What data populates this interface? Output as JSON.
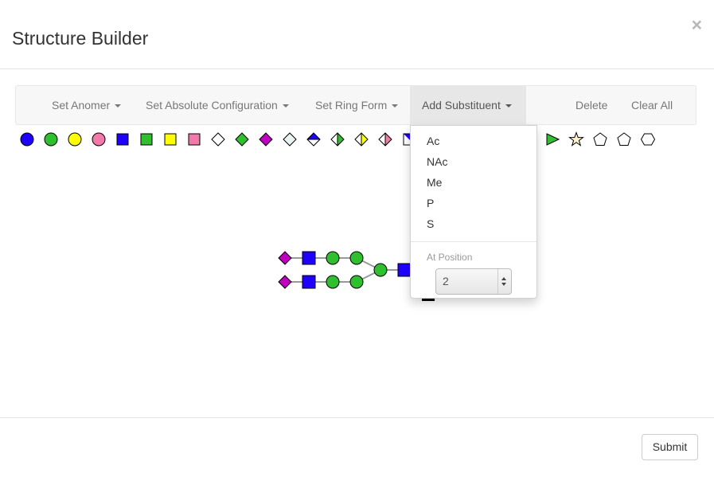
{
  "modal": {
    "title": "Structure Builder",
    "close_symbol": "×"
  },
  "toolbar": {
    "items": [
      {
        "label": "Set Anomer",
        "has_caret": true
      },
      {
        "label": "Set Absolute Configuration",
        "has_caret": true
      },
      {
        "label": "Set Ring Form",
        "has_caret": true
      },
      {
        "label": "Add Substituent",
        "has_caret": true,
        "active": true
      },
      {
        "label": "Delete",
        "has_caret": false
      },
      {
        "label": "Clear All",
        "has_caret": false
      }
    ]
  },
  "palette": {
    "symbols": [
      {
        "shape": "circle",
        "fill": "#1f00ff"
      },
      {
        "shape": "circle",
        "fill": "#2fbf2f"
      },
      {
        "shape": "circle",
        "fill": "#ffff00"
      },
      {
        "shape": "circle",
        "fill": "#f07aaa"
      },
      {
        "shape": "square",
        "fill": "#1f00ff"
      },
      {
        "shape": "square",
        "fill": "#2fbf2f"
      },
      {
        "shape": "square",
        "fill": "#ffff00"
      },
      {
        "shape": "square",
        "fill": "#f07aaa"
      },
      {
        "shape": "diamond",
        "fill": "#ffffff"
      },
      {
        "shape": "diamond",
        "fill": "#2fbf2f"
      },
      {
        "shape": "diamond",
        "fill": "#c000c0"
      },
      {
        "shape": "diamond-light",
        "fill": "#e8f4f4"
      },
      {
        "shape": "diamond-half-h",
        "fill": "#1f00ff"
      },
      {
        "shape": "diamond-half-v",
        "fill": "#2fbf2f"
      },
      {
        "shape": "diamond-half-v",
        "fill": "#ffff00"
      },
      {
        "shape": "diamond-half-v",
        "fill": "#f07aaa"
      },
      {
        "shape": "triangle",
        "fill": "#2fbf2f"
      },
      {
        "shape": "star",
        "fill": "#fff2cc"
      },
      {
        "shape": "pentagon",
        "fill": "#ffffff"
      },
      {
        "shape": "pentagon",
        "fill": "#ffffff"
      },
      {
        "shape": "hexagon",
        "fill": "#ffffff"
      }
    ]
  },
  "colors": {
    "hexnac_blue": "#1f00ff",
    "hex_green": "#2fbf2f",
    "neuac_purple": "#c000c0",
    "link_gray": "#999999"
  },
  "glycan": {
    "nodes": [
      {
        "id": "n1",
        "shape": "diamond",
        "fill": "#c000c0"
      },
      {
        "id": "n2",
        "shape": "square",
        "fill": "#1f00ff"
      },
      {
        "id": "n3",
        "shape": "circle",
        "fill": "#2fbf2f"
      },
      {
        "id": "n4",
        "shape": "circle",
        "fill": "#2fbf2f"
      },
      {
        "id": "n5",
        "shape": "diamond",
        "fill": "#c000c0"
      },
      {
        "id": "n6",
        "shape": "square",
        "fill": "#1f00ff"
      },
      {
        "id": "n7",
        "shape": "circle",
        "fill": "#2fbf2f"
      },
      {
        "id": "n8",
        "shape": "circle",
        "fill": "#2fbf2f"
      },
      {
        "id": "n9",
        "shape": "circle",
        "fill": "#2fbf2f"
      },
      {
        "id": "n10",
        "shape": "square",
        "fill": "#1f00ff"
      }
    ]
  },
  "dropdown": {
    "items": [
      "Ac",
      "NAc",
      "Me",
      "P",
      "S"
    ],
    "position_header": "At Position",
    "position_value": "2"
  },
  "footer": {
    "submit_label": "Submit"
  }
}
